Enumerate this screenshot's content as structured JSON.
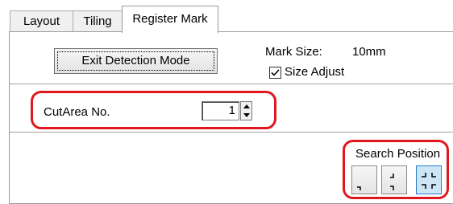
{
  "tabs": [
    {
      "label": "Layout",
      "active": false
    },
    {
      "label": "Tiling",
      "active": false
    },
    {
      "label": "Register Mark",
      "active": true
    }
  ],
  "register_mark": {
    "exit_button_label": "Exit Detection Mode",
    "mark_size_label": "Mark Size:",
    "mark_size_value": "10mm",
    "size_adjust_label": "Size Adjust",
    "size_adjust_checked": true,
    "cut_area_label": "CutArea No.",
    "cut_area_value": "1",
    "search_position_label": "Search Position",
    "search_position_options": [
      {
        "icon": "corner-bottom-left-icon",
        "selected": false
      },
      {
        "icon": "corners-two-right-icon",
        "selected": false
      },
      {
        "icon": "corners-four-icon",
        "selected": true
      }
    ]
  },
  "colors": {
    "highlight": "#e0181e",
    "selected_button": "#cde6f7",
    "selected_border": "#2a7ac9"
  }
}
